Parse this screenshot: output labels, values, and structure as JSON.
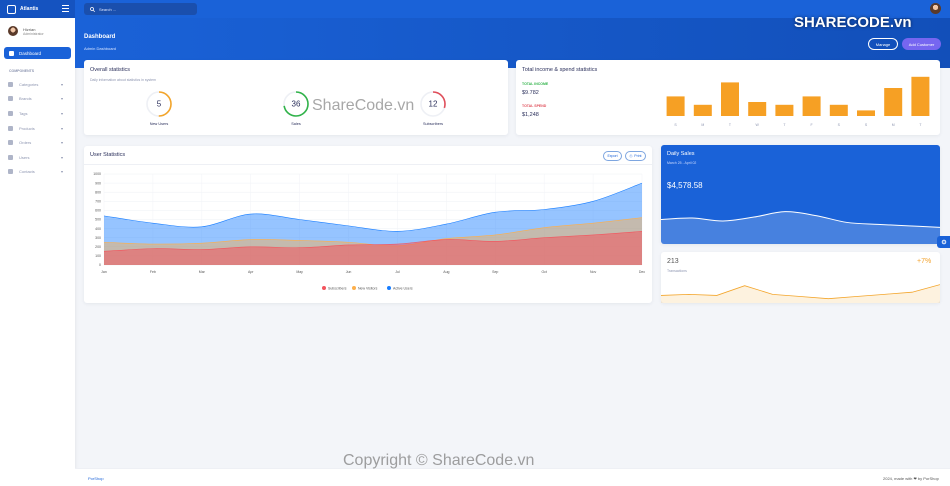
{
  "brand": {
    "name": "Atlantis"
  },
  "search": {
    "placeholder": "Search ..."
  },
  "user": {
    "name": "Hizrian",
    "role": "Administrator"
  },
  "sidebar": {
    "active": "Dashboard",
    "section": "COMPONENTS",
    "items": [
      {
        "label": "Categories"
      },
      {
        "label": "Brands"
      },
      {
        "label": "Tags"
      },
      {
        "label": "Products"
      },
      {
        "label": "Orders"
      },
      {
        "label": "Users"
      },
      {
        "label": "Contacts"
      }
    ]
  },
  "header": {
    "title": "Dashboard",
    "subtitle": "Admin Dashboard",
    "manage": "Manage",
    "add_customer": "Add Customer"
  },
  "overall": {
    "title": "Overall statistics",
    "subtitle": "Daily information about statistics in system",
    "stats": [
      {
        "label": "New Users",
        "value": "5",
        "fraction": 0.5,
        "color": "#f3a52b"
      },
      {
        "label": "Sales",
        "value": "36",
        "fraction": 0.72,
        "color": "#31b34a"
      },
      {
        "label": "Subscribers",
        "value": "12",
        "fraction": 0.3,
        "color": "#e04e5a"
      }
    ]
  },
  "income": {
    "title": "Total income & spend statistics",
    "income_label": "TOTAL INCOME",
    "income_value": "$9.782",
    "spend_label": "TOTAL SPEND",
    "spend_value": "$1,248",
    "income_color": "#31b34a",
    "spend_color": "#e04e5a"
  },
  "user_stats": {
    "title": "User Statistics",
    "export": "Export",
    "print": "Print"
  },
  "daily_sales": {
    "title": "Daily Sales",
    "range": "March 25 - April 02",
    "value": "$4,578.58"
  },
  "transactions": {
    "count": "213",
    "label": "Transactions",
    "change": "+7%"
  },
  "footer": {
    "left": "PorShop",
    "right": "2024, made with ❤ by PorShop"
  },
  "watermarks": {
    "logo": "SHARECODE.vn",
    "mid": "ShareCode.vn",
    "bottom": "Copyright © ShareCode.vn"
  },
  "chart_data": [
    {
      "type": "bar",
      "categories": [
        "S",
        "M",
        "T",
        "W",
        "T",
        "F",
        "S",
        "S",
        "M",
        "T"
      ],
      "values": [
        7,
        4,
        12,
        5,
        4,
        7,
        4,
        2,
        10,
        14
      ],
      "ylim": [
        0,
        15
      ],
      "color": "#f6a024",
      "grid": false
    },
    {
      "type": "area",
      "title": "",
      "categories": [
        "Jan",
        "Feb",
        "Mar",
        "Apr",
        "May",
        "Jun",
        "Jul",
        "Aug",
        "Sep",
        "Oct",
        "Nov",
        "Dec"
      ],
      "ylim": [
        0,
        1000
      ],
      "yticks": [
        0,
        100,
        200,
        300,
        400,
        500,
        600,
        700,
        800,
        900,
        1000
      ],
      "legend": "bottom",
      "grid": true,
      "series": [
        {
          "name": "Subscribers",
          "color": "#f3545d",
          "values": [
            150,
            180,
            170,
            200,
            190,
            220,
            230,
            280,
            260,
            300,
            330,
            370
          ]
        },
        {
          "name": "New Visitors",
          "color": "#fdaf4b",
          "values": [
            250,
            230,
            240,
            280,
            270,
            250,
            210,
            290,
            330,
            410,
            460,
            520
          ]
        },
        {
          "name": "Active Users",
          "color": "#177dff",
          "values": [
            540,
            460,
            420,
            560,
            500,
            430,
            370,
            450,
            580,
            610,
            700,
            900
          ]
        }
      ]
    },
    {
      "type": "area",
      "values": [
        50,
        53,
        47,
        55,
        66,
        58,
        44,
        40,
        37,
        34
      ],
      "ylim": [
        0,
        100
      ],
      "color": "#ffffff"
    },
    {
      "type": "area",
      "values": [
        14,
        16,
        14,
        32,
        16,
        12,
        8,
        12,
        16,
        20,
        34
      ],
      "ylim": [
        0,
        50
      ],
      "color": "#f3a52b"
    }
  ]
}
